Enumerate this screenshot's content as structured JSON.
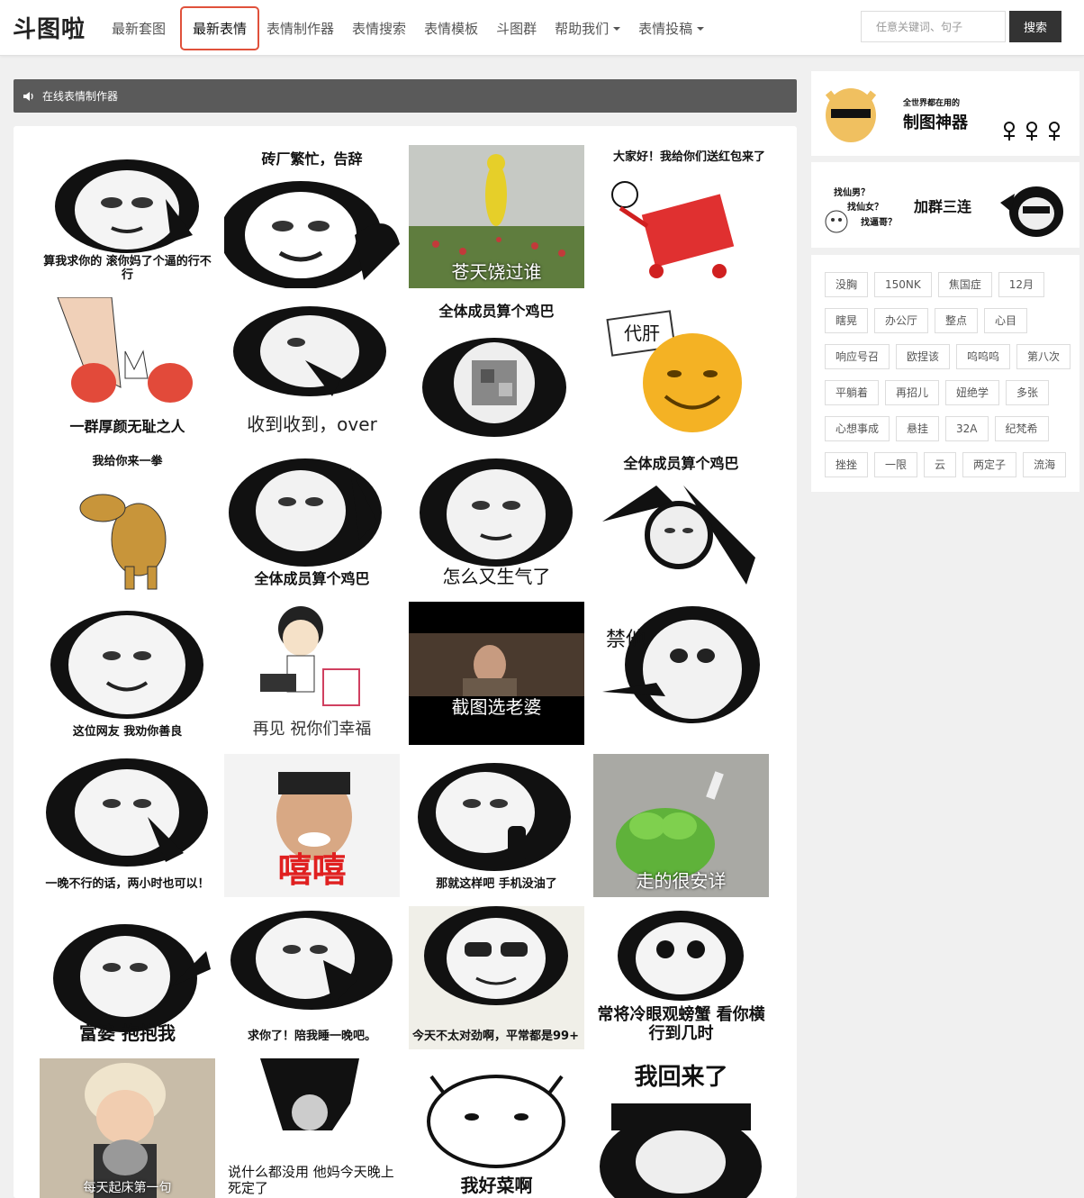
{
  "site": {
    "logo": "斗图啦"
  },
  "nav": {
    "items": [
      {
        "label": "最新套图"
      },
      {
        "label": "最新表情"
      },
      {
        "label": "表情制作器"
      },
      {
        "label": "表情搜索"
      },
      {
        "label": "表情模板"
      },
      {
        "label": "斗图群"
      },
      {
        "label": "帮助我们"
      },
      {
        "label": "表情投稿"
      }
    ]
  },
  "search": {
    "placeholder": "任意关键词、句子",
    "button": "搜索"
  },
  "banner": {
    "text": "在线表情制作器"
  },
  "grid": {
    "items": [
      {
        "caption": "算我求你的 滚你妈了个逼的行不行"
      },
      {
        "caption": "砖厂繁忙，告辞"
      },
      {
        "caption": "苍天饶过谁"
      },
      {
        "caption": "大家好！我给你们送红包来了"
      },
      {
        "caption": "一群厚颜无耻之人"
      },
      {
        "caption": "收到收到，over"
      },
      {
        "caption": "全体成员算个鸡巴"
      },
      {
        "caption": "代肝"
      },
      {
        "caption": "我给你来一拳"
      },
      {
        "caption": "全体成员算个鸡巴"
      },
      {
        "caption": "怎么又生气了"
      },
      {
        "caption": "全体成员算个鸡巴"
      },
      {
        "caption": "这位网友 我劝你善良"
      },
      {
        "caption": "再见 祝你们幸福"
      },
      {
        "caption": "截图选老婆"
      },
      {
        "caption": "禁他"
      },
      {
        "caption": "一晚不行的话，两小时也可以！"
      },
      {
        "caption": "嘻嘻"
      },
      {
        "caption": "那就这样吧 手机没油了"
      },
      {
        "caption": "走的很安详"
      },
      {
        "caption": "富婆 抱抱我"
      },
      {
        "caption": "求你了！陪我睡一晚吧。"
      },
      {
        "caption": "今天不太对劲啊，平常都是99+"
      },
      {
        "caption": "常将冷眼观螃蟹 看你横行到几时"
      },
      {
        "caption": "每天起床第一句"
      },
      {
        "caption": "说什么都没用 他妈今天晚上死定了"
      },
      {
        "caption": "我好菜啊"
      },
      {
        "caption": "我回来了"
      }
    ]
  },
  "sidebar": {
    "ad1": {
      "line1": "全世界都在用的",
      "line2": "制图神器"
    },
    "ad2": {
      "q1": "找仙男？",
      "q2": "找仙女？",
      "q3": "找逼哥？",
      "slogan": "加群三连"
    },
    "tags": [
      [
        "没胸",
        "150NK",
        "焦国症",
        "12月"
      ],
      [
        "瞎晃",
        "办公厅",
        "整点",
        "心目"
      ],
      [
        "响应号召",
        "欧捏该",
        "呜呜呜",
        "第八次"
      ],
      [
        "平躺着",
        "再招儿",
        "妞绝学",
        "多张"
      ],
      [
        "心想事成",
        "悬挂",
        "32A",
        "纪梵希"
      ],
      [
        "挫挫",
        "一限",
        "云",
        "两定子",
        "流海"
      ]
    ]
  }
}
